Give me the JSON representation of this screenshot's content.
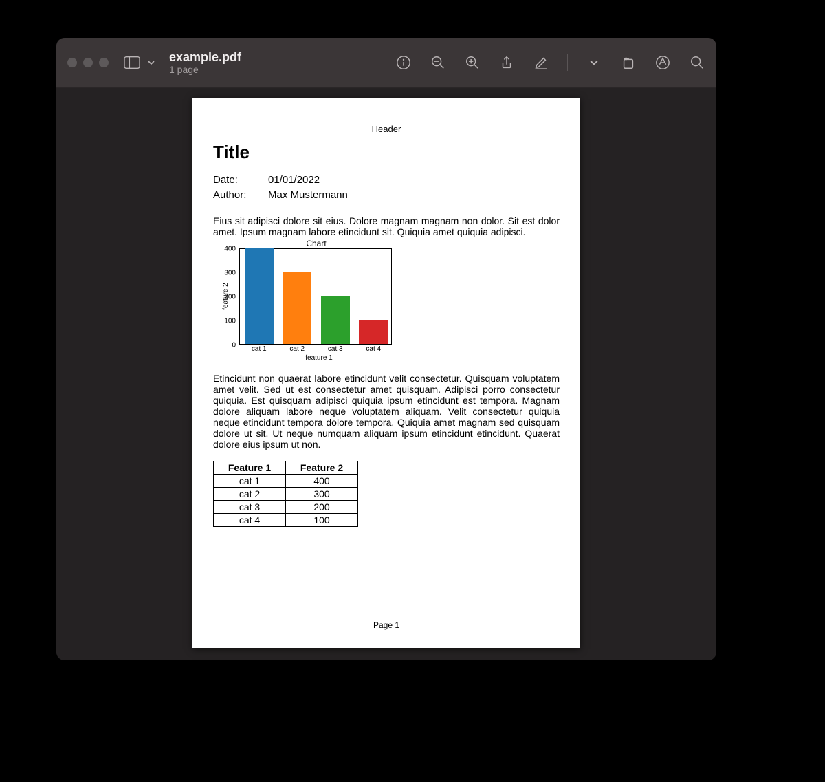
{
  "window": {
    "filename": "example.pdf",
    "page_count_label": "1 page"
  },
  "document": {
    "header": "Header",
    "footer": "Page 1",
    "title": "Title",
    "meta": {
      "date_label": "Date:",
      "date_value": "01/01/2022",
      "author_label": "Author:",
      "author_value": "Max Mustermann"
    },
    "paragraph1": "Eius sit adipisci dolore sit eius. Dolore magnam magnam non dolor. Sit est dolor amet. Ipsum magnam labore etincidunt sit. Quiquia amet quiquia adipisci.",
    "paragraph2": "Etincidunt non quaerat labore etincidunt velit consectetur. Quisquam voluptatem amet velit. Sed ut est consectetur amet quisquam. Adipisci porro consectetur quiquia. Est quisquam adipisci quiquia ipsum etincidunt est tempora. Magnam dolore aliquam labore neque voluptatem aliquam. Velit consectetur quiquia neque etincidunt tempora dolore tempora. Quiquia amet magnam sed quisquam dolore ut sit. Ut neque numquam aliquam ipsum etincidunt etincidunt. Quaerat dolore eius ipsum ut non.",
    "table": {
      "headers": [
        "Feature 1",
        "Feature 2"
      ],
      "rows": [
        [
          "cat 1",
          "400"
        ],
        [
          "cat 2",
          "300"
        ],
        [
          "cat 3",
          "200"
        ],
        [
          "cat 4",
          "100"
        ]
      ]
    }
  },
  "chart_data": {
    "type": "bar",
    "title": "Chart",
    "xlabel": "feature 1",
    "ylabel": "feature 2",
    "categories": [
      "cat 1",
      "cat 2",
      "cat 3",
      "cat 4"
    ],
    "values": [
      400,
      300,
      200,
      100
    ],
    "colors": [
      "#1f77b4",
      "#ff7f0e",
      "#2ca02c",
      "#d62728"
    ],
    "ylim": [
      0,
      400
    ],
    "yticks": [
      0,
      100,
      200,
      300,
      400
    ]
  }
}
